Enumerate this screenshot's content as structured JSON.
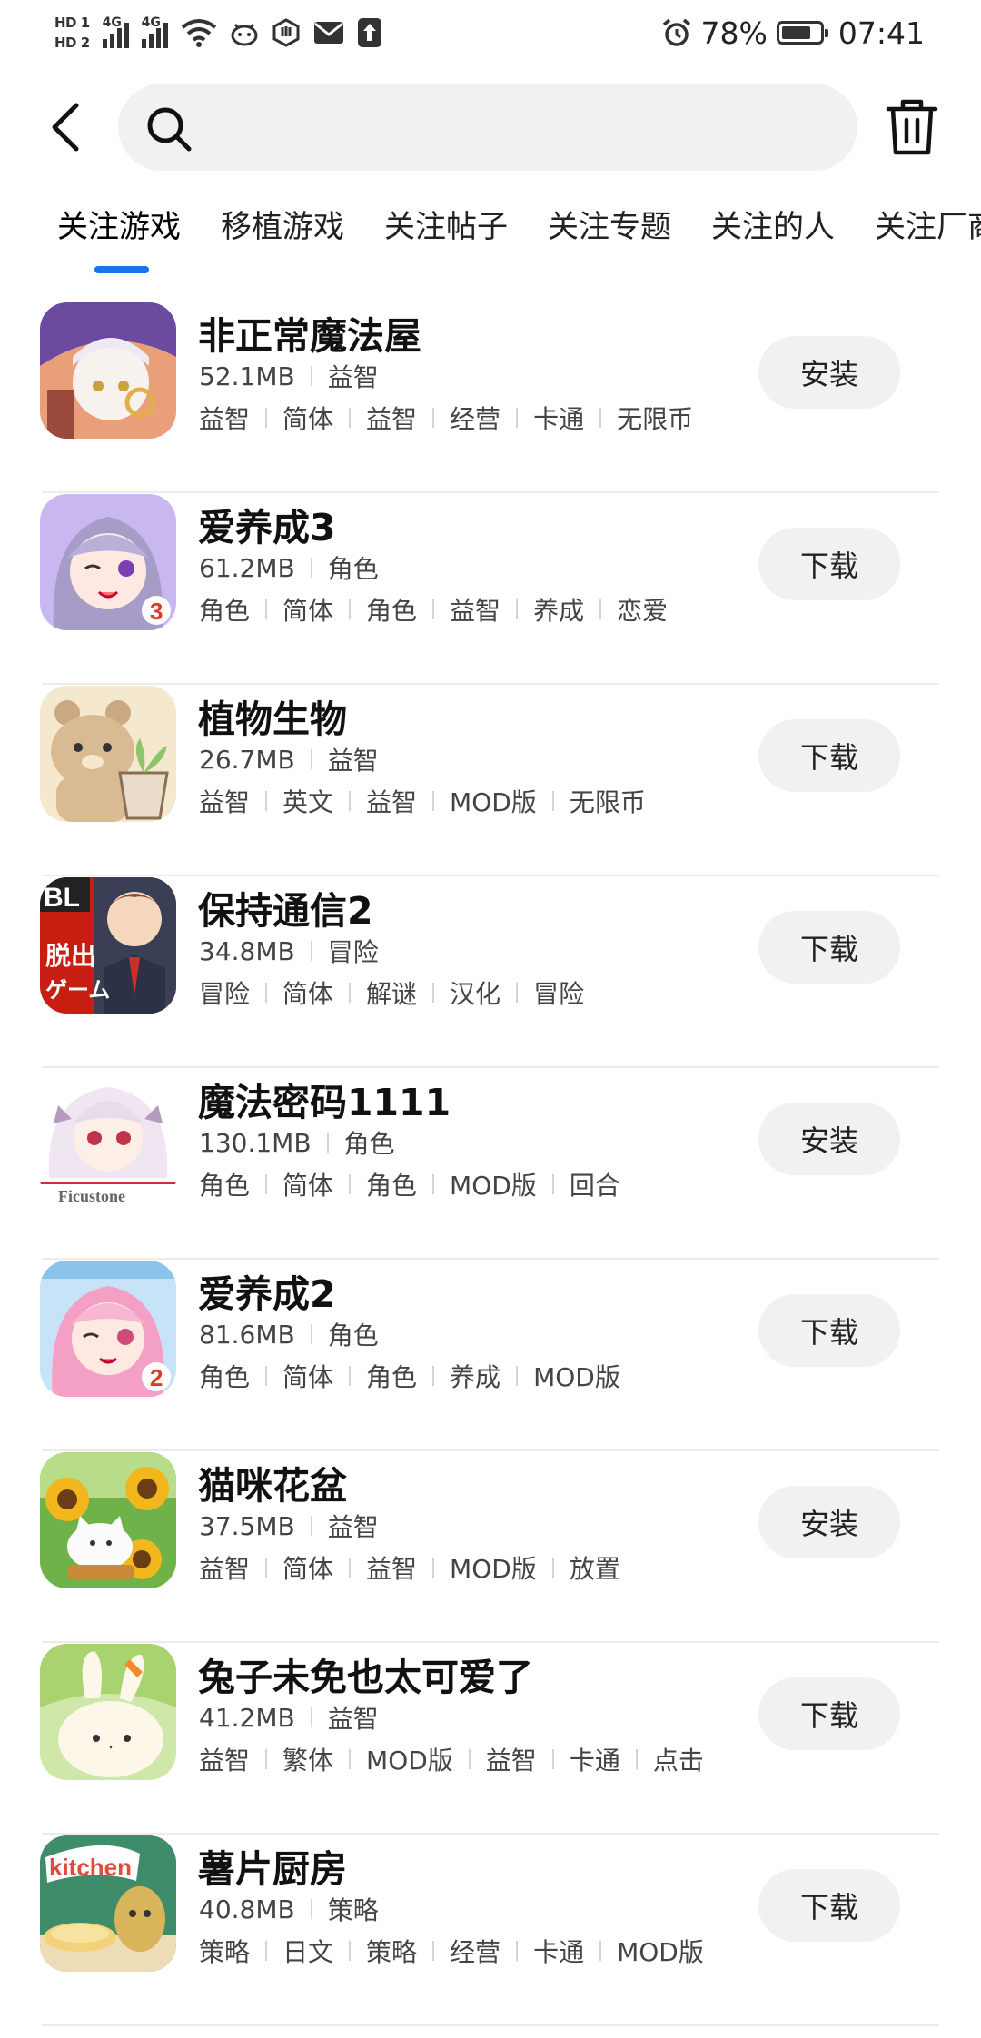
{
  "status_bar": {
    "hd1": "HD 1",
    "hd2": "HD 2",
    "net1": "4G",
    "net2": "4G",
    "battery_percent": "78%",
    "battery_level": 0.78,
    "time": "07:41"
  },
  "search": {
    "placeholder": ""
  },
  "tabs": [
    {
      "label": "关注游戏"
    },
    {
      "label": "移植游戏"
    },
    {
      "label": "关注帖子"
    },
    {
      "label": "关注专题"
    },
    {
      "label": "关注的人"
    },
    {
      "label": "关注厂商"
    }
  ],
  "active_tab_index": 0,
  "games": [
    {
      "title": "非正常魔法屋",
      "size": "52.1MB",
      "category": "益智",
      "tags": [
        "益智",
        "简体",
        "益智",
        "经营",
        "卡通",
        "无限币"
      ],
      "action": "安装",
      "icon": "witch-girl-icon"
    },
    {
      "title": "爱养成3",
      "size": "61.2MB",
      "category": "角色",
      "tags": [
        "角色",
        "简体",
        "角色",
        "益智",
        "养成",
        "恋爱"
      ],
      "action": "下载",
      "icon": "anime-girl-icon"
    },
    {
      "title": "植物生物",
      "size": "26.7MB",
      "category": "益智",
      "tags": [
        "益智",
        "英文",
        "益智",
        "MOD版",
        "无限币"
      ],
      "action": "下载",
      "icon": "bear-plant-icon"
    },
    {
      "title": "保持通信2",
      "size": "34.8MB",
      "category": "冒险",
      "tags": [
        "冒险",
        "简体",
        "解谜",
        "汉化",
        "冒险"
      ],
      "action": "下载",
      "icon": "escape-game-icon"
    },
    {
      "title": "魔法密码1111",
      "size": "130.1MB",
      "category": "角色",
      "tags": [
        "角色",
        "简体",
        "角色",
        "MOD版",
        "回合"
      ],
      "action": "安装",
      "icon": "ficustone-girl-icon"
    },
    {
      "title": "爱养成2",
      "size": "81.6MB",
      "category": "角色",
      "tags": [
        "角色",
        "简体",
        "角色",
        "养成",
        "MOD版"
      ],
      "action": "下载",
      "icon": "pink-hair-girl-icon"
    },
    {
      "title": "猫咪花盆",
      "size": "37.5MB",
      "category": "益智",
      "tags": [
        "益智",
        "简体",
        "益智",
        "MOD版",
        "放置"
      ],
      "action": "安装",
      "icon": "sunflower-cat-icon"
    },
    {
      "title": "兔子未免也太可爱了",
      "size": "41.2MB",
      "category": "益智",
      "tags": [
        "益智",
        "繁体",
        "MOD版",
        "益智",
        "卡通",
        "点击"
      ],
      "action": "下载",
      "icon": "bunny-icon"
    },
    {
      "title": "薯片厨房",
      "size": "40.8MB",
      "category": "策略",
      "tags": [
        "策略",
        "日文",
        "策略",
        "经营",
        "卡通",
        "MOD版"
      ],
      "action": "下载",
      "icon": "potato-kitchen-icon"
    }
  ]
}
